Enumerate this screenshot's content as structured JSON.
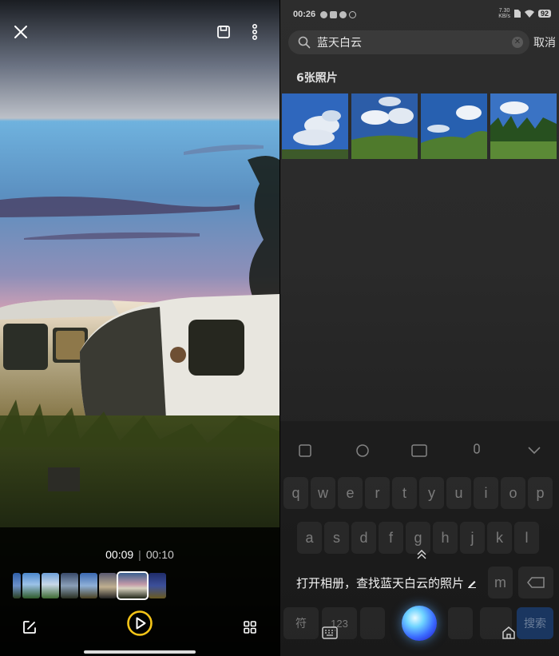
{
  "left_panel": {
    "icons": {
      "close": "close-icon",
      "save": "save-icon",
      "more": "more-vertical-icon",
      "edit": "edit-icon",
      "play": "play-icon",
      "grid": "grid-icon"
    },
    "current_time": "00:09",
    "separator": "|",
    "total_time": "00:10",
    "accent_color": "#f5c518"
  },
  "right_panel": {
    "status_bar": {
      "time": "00:26",
      "net_speed_value": "7.30",
      "net_speed_unit": "KB/s",
      "battery": "92"
    },
    "search": {
      "query": "蓝天白云",
      "cancel_label": "取消"
    },
    "results_count_label": "6张照片",
    "keyboard": {
      "row1": [
        "q",
        "w",
        "e",
        "r",
        "t",
        "y",
        "u",
        "i",
        "o",
        "p"
      ],
      "row2": [
        "a",
        "s",
        "d",
        "f",
        "g",
        "h",
        "j",
        "k",
        "l"
      ],
      "row3_visible": [
        "m"
      ],
      "bottom_left_key": "符",
      "number_key": "123",
      "search_key": "搜索"
    },
    "assistant": {
      "prompt": "打开相册，查找蓝天白云的照片"
    }
  }
}
